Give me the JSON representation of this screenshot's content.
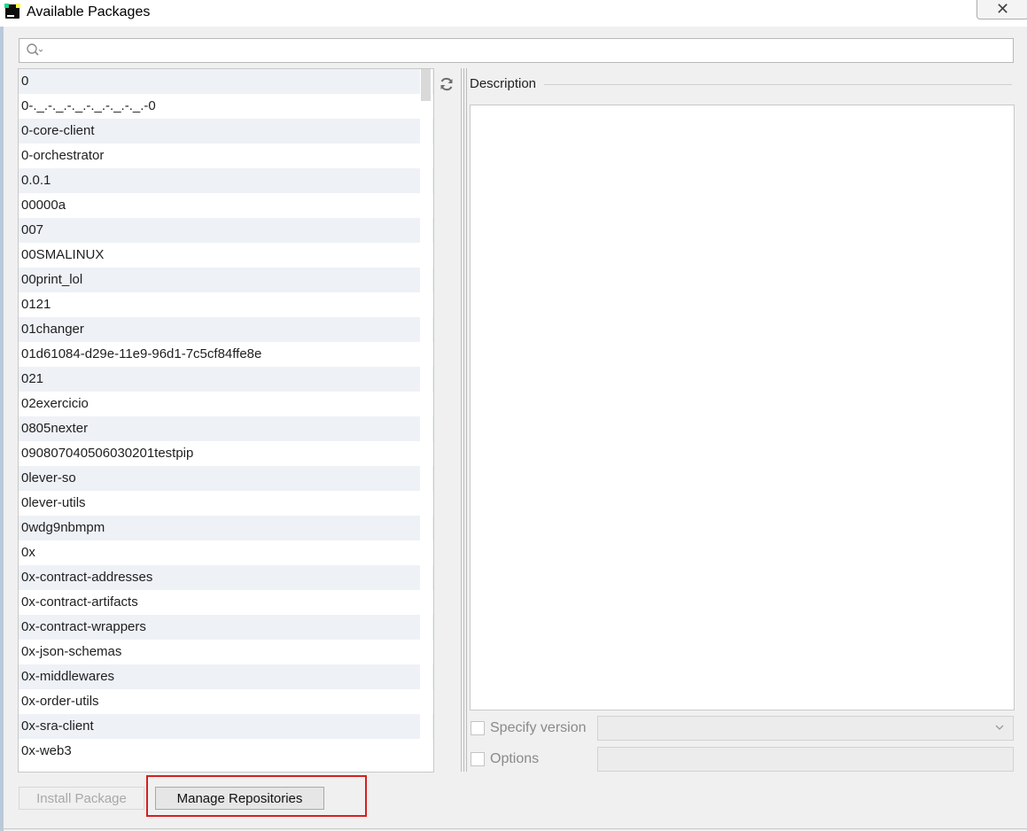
{
  "window": {
    "title": "Available Packages",
    "close_symbol": "✕",
    "app_icon": "pycharm-icon"
  },
  "search": {
    "value": "",
    "placeholder": "",
    "icon": "search-icon"
  },
  "packages": [
    "0",
    "0-._.-._.-._.-._.-._.-._.-0",
    "0-core-client",
    "0-orchestrator",
    "0.0.1",
    "00000a",
    "007",
    "00SMALINUX",
    "00print_lol",
    "0121",
    "01changer",
    "01d61084-d29e-11e9-96d1-7c5cf84ffe8e",
    "021",
    "02exercicio",
    "0805nexter",
    "090807040506030201testpip",
    "0lever-so",
    "0lever-utils",
    "0wdg9nbmpm",
    "0x",
    "0x-contract-addresses",
    "0x-contract-artifacts",
    "0x-contract-wrappers",
    "0x-json-schemas",
    "0x-middlewares",
    "0x-order-utils",
    "0x-sra-client",
    "0x-web3"
  ],
  "refresh_icon": "refresh-icon",
  "description": {
    "label": "Description",
    "text": ""
  },
  "options": {
    "specify_version_label": "Specify version",
    "specify_version_checked": false,
    "version_value": "",
    "options_label": "Options",
    "options_checked": false,
    "options_value": ""
  },
  "buttons": {
    "install": "Install Package",
    "manage": "Manage Repositories"
  },
  "colors": {
    "highlight": "#d42020",
    "row_alt": "#eef1f6"
  }
}
